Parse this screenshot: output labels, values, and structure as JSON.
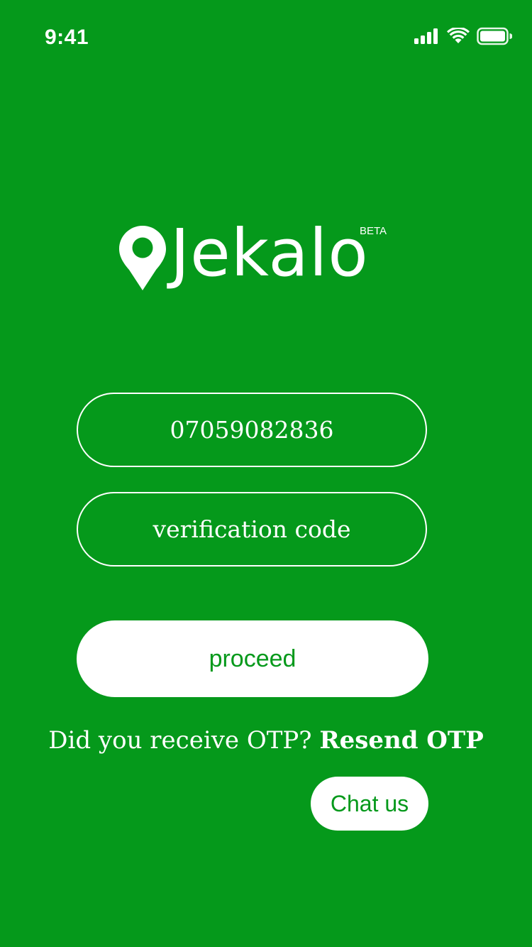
{
  "status_bar": {
    "time": "9:41",
    "signal_icon": "cellular-signal-icon",
    "wifi_icon": "wifi-icon",
    "battery_icon": "battery-icon"
  },
  "logo": {
    "pin_icon": "location-pin-icon",
    "brand_name": "Jekalo",
    "badge": "BETA"
  },
  "form": {
    "phone_value": "07059082836",
    "code_placeholder": "verification code",
    "proceed_label": "proceed"
  },
  "otp": {
    "prompt": "Did you receive OTP?",
    "resend_label": "Resend OTP"
  },
  "chat": {
    "label": "Chat us"
  },
  "colors": {
    "background": "#05991b",
    "foreground": "#ffffff"
  }
}
